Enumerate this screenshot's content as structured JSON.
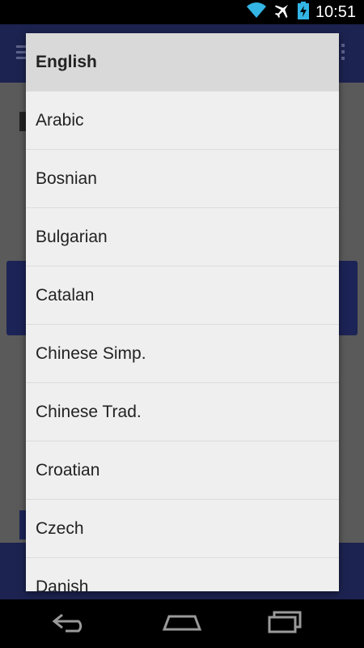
{
  "status_bar": {
    "time": "10:51",
    "icons": [
      "wifi-icon",
      "airplane-icon",
      "battery-charging-icon"
    ]
  },
  "dialog": {
    "languages": [
      {
        "label": "English",
        "selected": true
      },
      {
        "label": "Arabic",
        "selected": false
      },
      {
        "label": "Bosnian",
        "selected": false
      },
      {
        "label": "Bulgarian",
        "selected": false
      },
      {
        "label": "Catalan",
        "selected": false
      },
      {
        "label": "Chinese Simp.",
        "selected": false
      },
      {
        "label": "Chinese Trad.",
        "selected": false
      },
      {
        "label": "Croatian",
        "selected": false
      },
      {
        "label": "Czech",
        "selected": false
      },
      {
        "label": "Danish",
        "selected": false
      }
    ]
  },
  "nav_bar": {
    "buttons": [
      "back-icon",
      "home-icon",
      "recent-apps-icon"
    ]
  },
  "colors": {
    "status_bar": "#000000",
    "action_bar": "#1c2350",
    "dialog_bg": "#efefef",
    "selected_item": "#d9d9d9",
    "accent_wifi": "#33b5e5"
  }
}
